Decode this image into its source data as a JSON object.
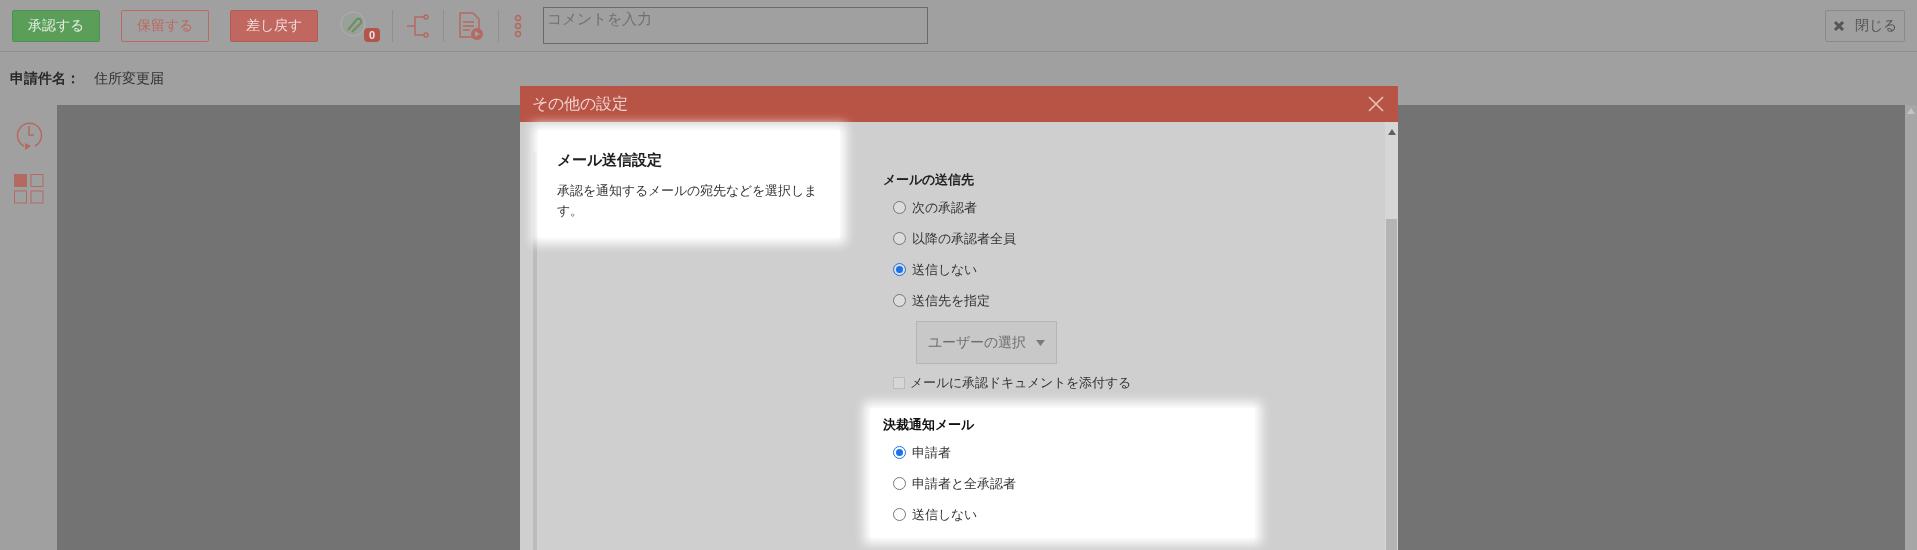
{
  "toolbar": {
    "buttons": [
      {
        "label": "承認する",
        "kind": "approve"
      },
      {
        "label": "保留する",
        "kind": "hold"
      },
      {
        "label": "差し戻す",
        "kind": "return"
      }
    ],
    "attachment_count": "0",
    "comment": {
      "placeholder": "コメントを入力"
    },
    "close_label": "閉じる"
  },
  "subject": {
    "label": "申請件名：",
    "value": "住所変更届"
  },
  "dialog": {
    "title": "その他の設定",
    "section": {
      "title": "メール送信設定",
      "description": "承認を通知するメールの宛先などを選択します。"
    },
    "recipients": {
      "label": "メールの送信先",
      "options": [
        {
          "label": "次の承認者",
          "selected": false
        },
        {
          "label": "以降の承認者全員",
          "selected": false
        },
        {
          "label": "送信しない",
          "selected": true
        },
        {
          "label": "送信先を指定",
          "selected": false
        }
      ],
      "user_select": "ユーザーの選択",
      "attach": {
        "label": "メールに承認ドキュメントを添付する",
        "checked": false
      }
    },
    "decision_mail": {
      "label": "決裁通知メール",
      "options": [
        {
          "label": "申請者",
          "selected": true
        },
        {
          "label": "申請者と全承認者",
          "selected": false
        },
        {
          "label": "送信しない",
          "selected": false
        }
      ]
    }
  }
}
